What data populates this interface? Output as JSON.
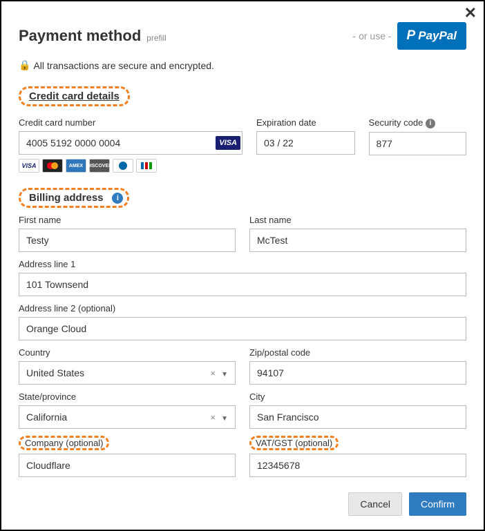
{
  "header": {
    "title": "Payment method",
    "prefill": "prefill",
    "or_use": "- or use -",
    "paypal": "PayPal"
  },
  "secure_text": "All transactions are secure and encrypted.",
  "cc_section": {
    "heading": "Credit card details",
    "number_label": "Credit card number",
    "number_value": "4005 5192 0000 0004",
    "visa_chip": "VISA",
    "exp_label": "Expiration date",
    "exp_value": "03 / 22",
    "cvv_label": "Security code",
    "cvv_value": "877"
  },
  "brands": {
    "visa": "VISA",
    "amex": "AMEX",
    "disc": "DISCOVER"
  },
  "billing": {
    "heading": "Billing address",
    "first_label": "First name",
    "first_value": "Testy",
    "last_label": "Last name",
    "last_value": "McTest",
    "addr1_label": "Address line 1",
    "addr1_value": "101 Townsend",
    "addr2_label": "Address line 2 (optional)",
    "addr2_value": "Orange Cloud",
    "country_label": "Country",
    "country_value": "United States",
    "zip_label": "Zip/postal code",
    "zip_value": "94107",
    "state_label": "State/province",
    "state_value": "California",
    "city_label": "City",
    "city_value": "San Francisco",
    "company_label": "Company (optional)",
    "company_value": "Cloudflare",
    "vat_label": "VAT/GST (optional)",
    "vat_value": "12345678"
  },
  "buttons": {
    "cancel": "Cancel",
    "confirm": "Confirm"
  }
}
